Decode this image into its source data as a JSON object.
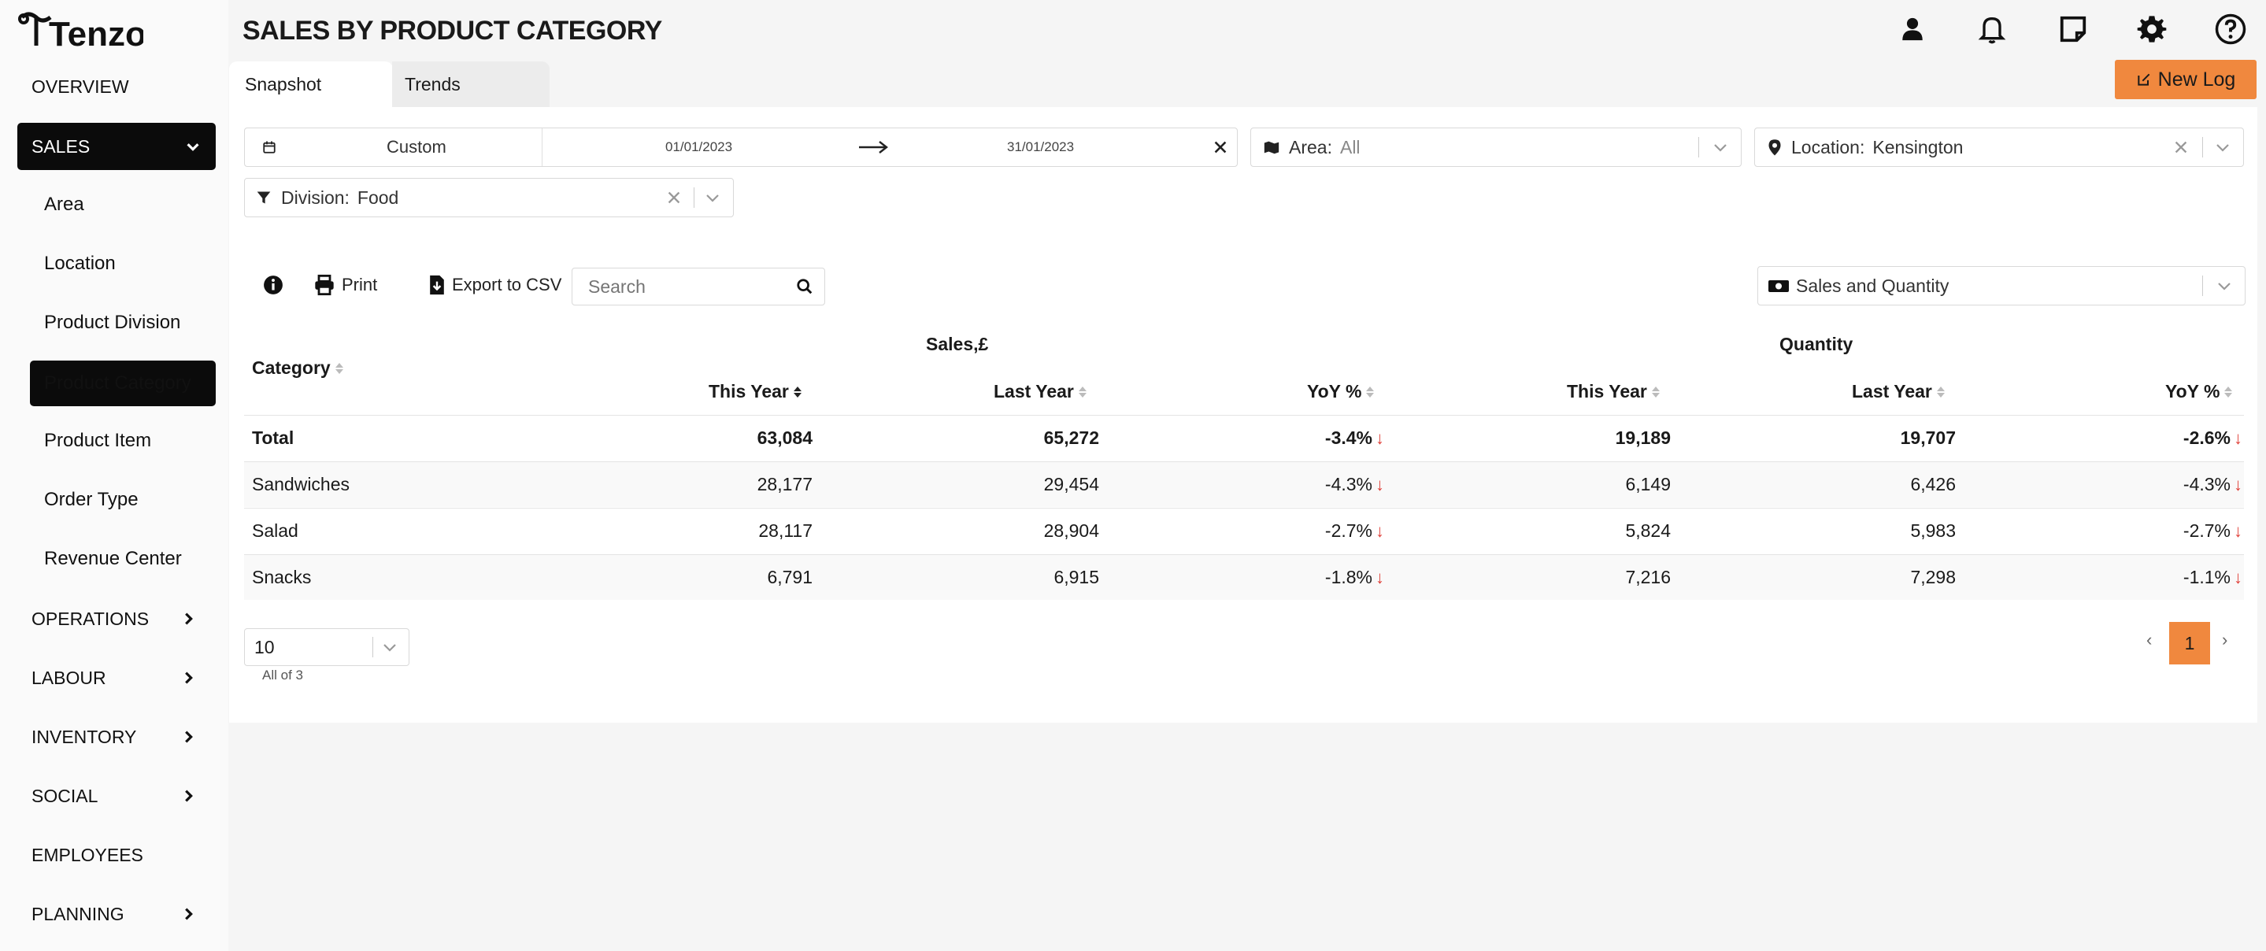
{
  "app": {
    "logo_text": "Tenzo"
  },
  "sidebar": {
    "top_items": [
      {
        "label": "OVERVIEW"
      },
      {
        "label": "SALES"
      }
    ],
    "sales_sub": [
      {
        "label": "Area"
      },
      {
        "label": "Location"
      },
      {
        "label": "Product Division"
      },
      {
        "label": "Product Category"
      },
      {
        "label": "Product Item"
      },
      {
        "label": "Order Type"
      },
      {
        "label": "Revenue Center"
      }
    ],
    "bottom_items": [
      {
        "label": "OPERATIONS"
      },
      {
        "label": "LABOUR"
      },
      {
        "label": "INVENTORY"
      },
      {
        "label": "SOCIAL"
      },
      {
        "label": "EMPLOYEES"
      },
      {
        "label": "PLANNING"
      }
    ]
  },
  "header": {
    "title": "SALES BY PRODUCT CATEGORY",
    "icons": [
      "user-icon",
      "bell-icon",
      "note-icon",
      "gear-icon",
      "help-icon"
    ],
    "new_log_label": "New Log"
  },
  "tabs": [
    {
      "label": "Snapshot",
      "active": true
    },
    {
      "label": "Trends",
      "active": false
    }
  ],
  "filters": {
    "date_mode": "Custom",
    "date_from": "01/01/2023",
    "date_to": "31/01/2023",
    "area_label": "Area:",
    "area_value": "All",
    "location_label": "Location:",
    "location_value": "Kensington",
    "division_label": "Division:",
    "division_value": "Food"
  },
  "toolbar": {
    "print_label": "Print",
    "export_label": "Export to CSV",
    "search_placeholder": "Search",
    "view_select": "Sales and Quantity"
  },
  "table": {
    "category_header": "Category",
    "group_sales": "Sales,£",
    "group_quantity": "Quantity",
    "col_this_year": "This Year",
    "col_last_year": "Last Year",
    "col_yoy": "YoY %",
    "rows": [
      {
        "category": "Total",
        "sales_ty": "63,084",
        "sales_ly": "65,272",
        "sales_yoy": "-3.4%",
        "qty_ty": "19,189",
        "qty_ly": "19,707",
        "qty_yoy": "-2.6%"
      },
      {
        "category": "Sandwiches",
        "sales_ty": "28,177",
        "sales_ly": "29,454",
        "sales_yoy": "-4.3%",
        "qty_ty": "6,149",
        "qty_ly": "6,426",
        "qty_yoy": "-4.3%"
      },
      {
        "category": "Salad",
        "sales_ty": "28,117",
        "sales_ly": "28,904",
        "sales_yoy": "-2.7%",
        "qty_ty": "5,824",
        "qty_ly": "5,983",
        "qty_yoy": "-2.7%"
      },
      {
        "category": "Snacks",
        "sales_ty": "6,791",
        "sales_ly": "6,915",
        "sales_yoy": "-1.8%",
        "qty_ty": "7,216",
        "qty_ly": "7,298",
        "qty_yoy": "-1.1%"
      }
    ]
  },
  "pagination": {
    "page_size": "10",
    "summary": "All of 3",
    "current_page": "1",
    "prev": "‹",
    "next": "›"
  },
  "colors": {
    "accent": "#f0883e",
    "negative": "#e0413a",
    "active_nav": "#0b0b0b"
  }
}
